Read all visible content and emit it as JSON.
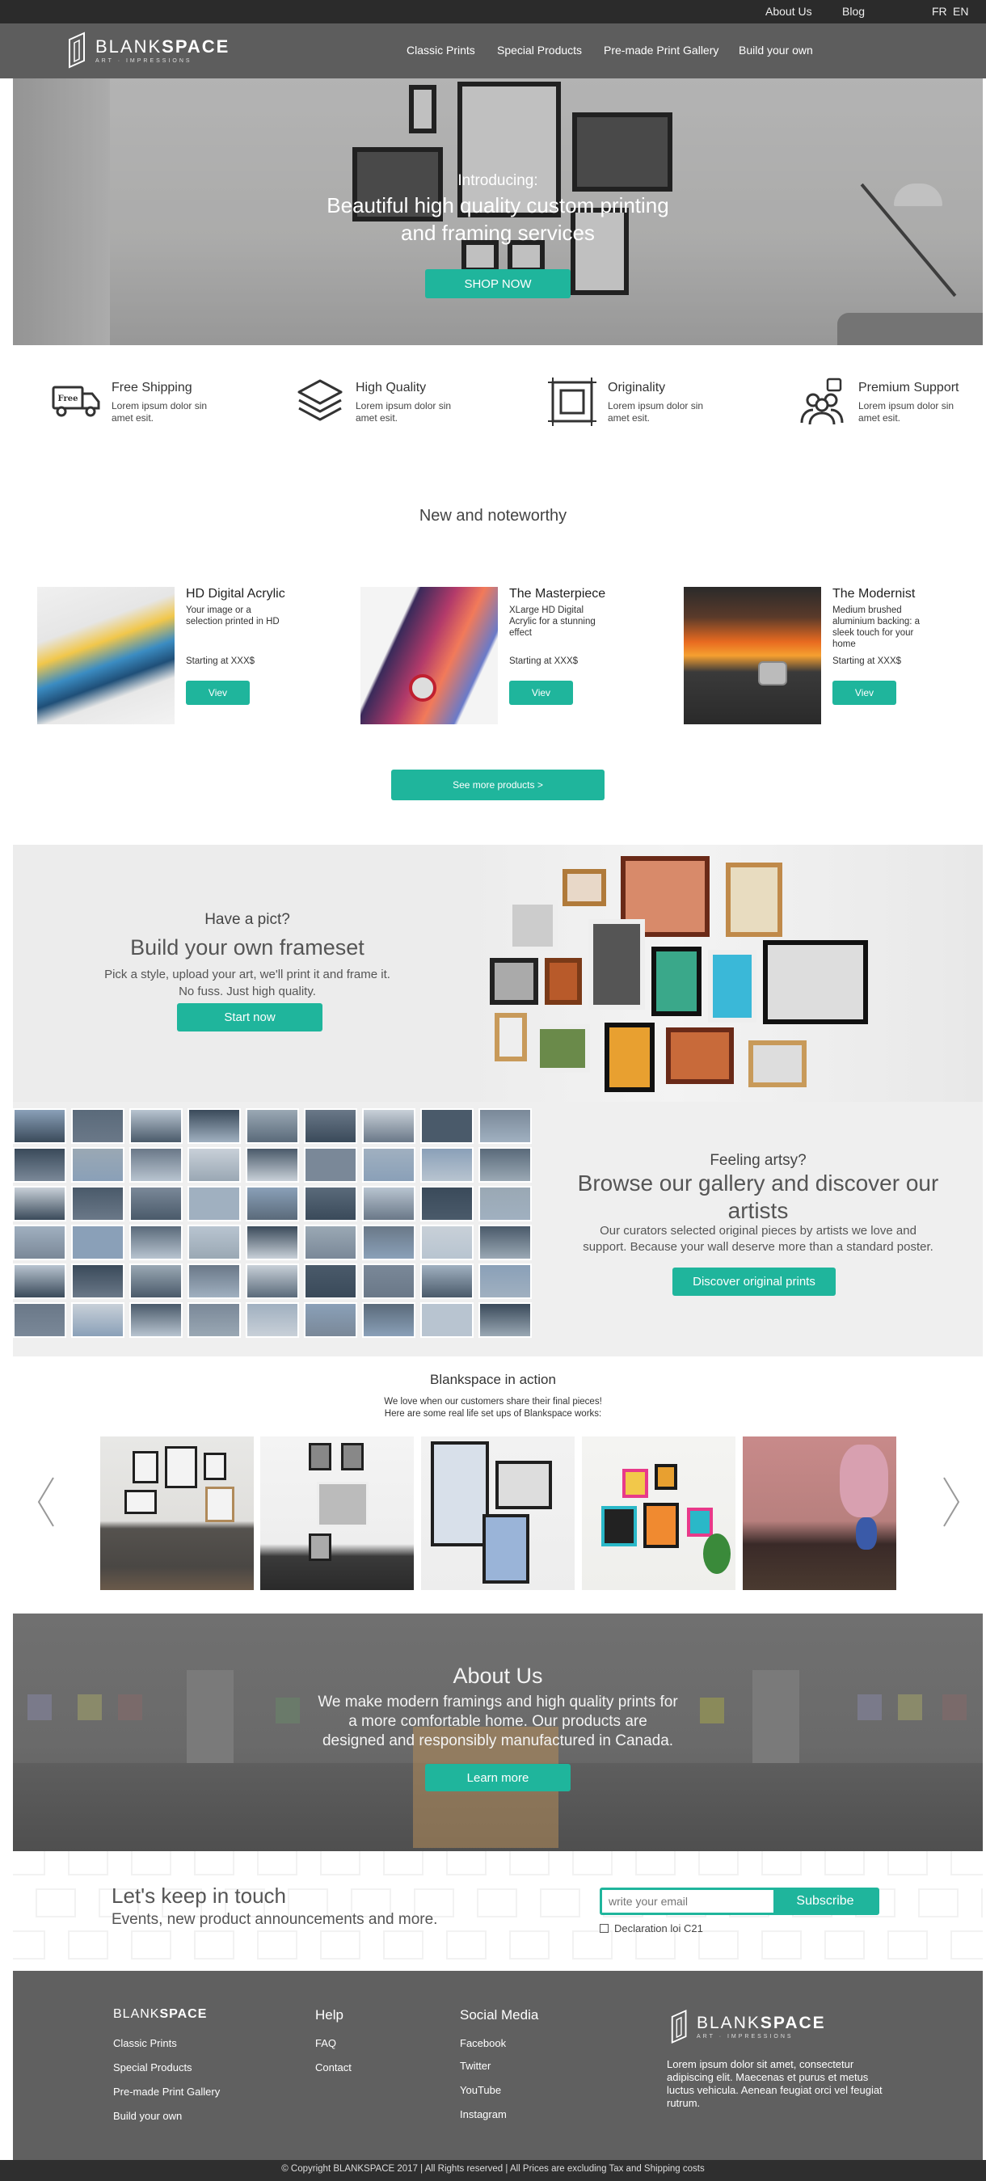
{
  "topbar": {
    "links": [
      "About Us",
      "Blog"
    ],
    "languages": [
      "FR",
      "EN"
    ]
  },
  "brand": {
    "name_light": "BLANK",
    "name_bold": "SPACE",
    "tagline": "ART · IMPRESSIONS"
  },
  "nav": {
    "items": [
      "Classic Prints",
      "Special Products",
      "Pre-made Print Gallery",
      "Build your own"
    ]
  },
  "hero": {
    "intro": "Introducing:",
    "title_line1": "Beautiful high quality custom printing",
    "title_line2": "and framing services",
    "button": "SHOP NOW"
  },
  "features": [
    {
      "title": "Free Shipping",
      "desc": "Lorem ipsum dolor sin amet esit.",
      "icon": "truck-icon",
      "icon_text": "Free"
    },
    {
      "title": "High Quality",
      "desc": "Lorem ipsum dolor sin amet esit.",
      "icon": "layers-icon"
    },
    {
      "title": "Originality",
      "desc": "Lorem ipsum dolor sin amet esit.",
      "icon": "frame-icon"
    },
    {
      "title": "Premium Support",
      "desc": "Lorem ipsum dolor sin amet esit.",
      "icon": "support-icon"
    }
  ],
  "noteworthy": {
    "heading": "New and noteworthy",
    "products": [
      {
        "title": "HD Digital Acrylic",
        "desc": "Your image or a selection printed in HD",
        "price": "Starting at XXX$",
        "button": "Viev"
      },
      {
        "title": "The Masterpiece",
        "desc": "XLarge HD Digital Acrylic for a stunning effect",
        "price": "Starting at XXX$",
        "button": "Viev"
      },
      {
        "title": "The Modernist",
        "desc": "Medium brushed aluminium backing: a sleek touch for your home",
        "price": "Starting at XXX$",
        "button": "Viev"
      }
    ],
    "more_button": "See more products >"
  },
  "build": {
    "question": "Have a pict?",
    "title": "Build your own frameset",
    "desc_line1": "Pick a style, upload your art, we'll print it and frame it.",
    "desc_line2": "No fuss. Just high quality.",
    "button": "Start now"
  },
  "gallery": {
    "question": "Feeling artsy?",
    "title_line1": "Browse our gallery and discover our",
    "title_line2": "artists",
    "desc_line1": "Our curators selected original pieces by artists we love and",
    "desc_line2": "support. Because your wall deserve more than a standard poster.",
    "button": "Discover original prints"
  },
  "in_action": {
    "title": "Blankspace in action",
    "sub_line1": "We love when our customers share their final pieces!",
    "sub_line2": "Here are some real life set ups of Blankspace works:"
  },
  "about": {
    "title": "About Us",
    "desc_line1": "We make modern framings and high quality prints for",
    "desc_line2": "a more comfortable home. Our products are",
    "desc_line3": "designed and responsibly manufactured in Canada.",
    "button": "Learn more"
  },
  "newsletter": {
    "title": "Let's keep in touch",
    "subtitle": "Events, new product announcements and more.",
    "placeholder": "write your email",
    "button": "Subscribe",
    "checkbox_label": "Declaration loi C21"
  },
  "footer": {
    "col1": {
      "links": [
        "Classic Prints",
        "Special Products",
        "Pre-made Print Gallery",
        "Build your own"
      ]
    },
    "col2": {
      "title": "Help",
      "links": [
        "FAQ",
        "Contact"
      ]
    },
    "col3": {
      "title": "Social Media",
      "links": [
        "Facebook",
        "Twitter",
        "YouTube",
        "Instagram"
      ]
    },
    "about_text": "Lorem ipsum dolor sit amet, consectetur adipiscing elit. Maecenas et purus et metus luctus vehicula. Aenean feugiat orci vel feugiat rutrum.",
    "copyright": "© Copyright BLANKSPACE 2017 | All Rights reserved | All Prices are excluding Tax and Shipping costs"
  },
  "colors": {
    "accent": "#1fb59c",
    "topbar": "#2b2b2b",
    "nav": "#5d5d5d",
    "footer": "#606060"
  }
}
